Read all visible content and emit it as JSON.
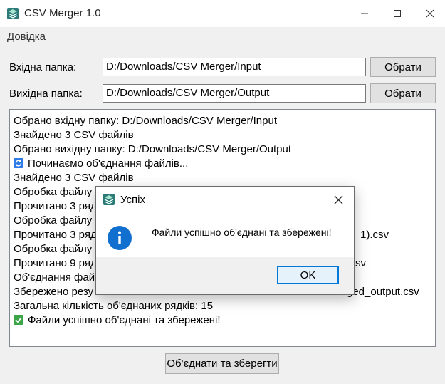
{
  "window": {
    "title": "CSV Merger 1.0"
  },
  "menu": {
    "items": [
      {
        "label": "Довідка"
      }
    ]
  },
  "input_folder": {
    "label": "Вхідна папка:",
    "value": "D:/Downloads/CSV Merger/Input",
    "button": "Обрати"
  },
  "output_folder": {
    "label": "Вихідна папка:",
    "value": "D:/Downloads/CSV Merger/Output",
    "button": "Обрати"
  },
  "log": {
    "lines": [
      "Обрано вхідну папку: D:/Downloads/CSV Merger/Input",
      "Знайдено 3 CSV файлів",
      "Обрано вихідну папку: D:/Downloads/CSV Merger/Output",
      "Починаємо об'єднання файлів...",
      "Знайдено 3 CSV файлів",
      "Обробка файлу",
      "Прочитано 3 ряд",
      "Обробка файлу 2",
      "Прочитано 3 ряд",
      "Обробка файлу 3",
      "Прочитано 9 ряд",
      "Об'єднання файл",
      "Збережено резу",
      "Загальна кількість об'єднаних рядків: 15",
      "Файли успішно об'єднані та збережені!"
    ],
    "fragments": {
      "line9_tail": "1).csv",
      "line11_tail": "sv",
      "line13_tail": "ged_output.csv"
    },
    "icons": {
      "line4": "sync-emoji-icon",
      "line15": "check-emoji-icon"
    }
  },
  "merge_button": {
    "label": "Об'єднати та зберегти"
  },
  "dialog": {
    "title": "Успіх",
    "message": "Файли успішно об'єднані та збережені!",
    "ok_label": "OK",
    "icon": "info-icon"
  },
  "colors": {
    "accent": "#0078d7",
    "info_icon": "#1170cf",
    "sync_emoji": "#2f7be6",
    "check_emoji": "#3ca548"
  }
}
